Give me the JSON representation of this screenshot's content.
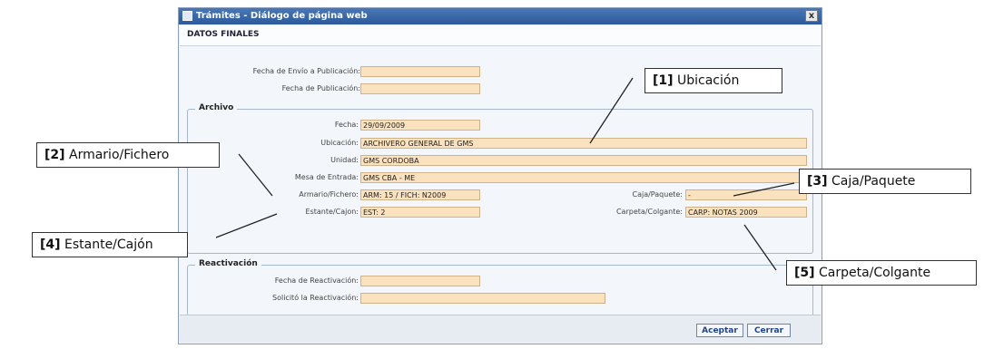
{
  "window": {
    "title": "Trámites - Diálogo de página web",
    "close_symbol": "x"
  },
  "header": {
    "title": "DATOS FINALES"
  },
  "fields": {
    "fecha_envio": {
      "label": "Fecha de Envío a Publicación:",
      "value": ""
    },
    "fecha_publicacion": {
      "label": "Fecha de Publicación:",
      "value": ""
    }
  },
  "archivo": {
    "legend": "Archivo",
    "fecha": {
      "label": "Fecha:",
      "value": "29/09/2009"
    },
    "ubicacion": {
      "label": "Ubicación:",
      "value": "ARCHIVERO GENERAL DE GMS"
    },
    "unidad": {
      "label": "Unidad:",
      "value": "GMS CORDOBA"
    },
    "mesa": {
      "label": "Mesa de Entrada:",
      "value": "GMS CBA - ME"
    },
    "armario": {
      "label": "Armario/Fichero:",
      "value": "ARM: 15 / FICH: N2009"
    },
    "caja": {
      "label": "Caja/Paquete:",
      "value": "-"
    },
    "estante": {
      "label": "Estante/Cajon:",
      "value": "EST: 2"
    },
    "carpeta": {
      "label": "Carpeta/Colgante:",
      "value": "CARP: NOTAS 2009"
    }
  },
  "reactivacion": {
    "legend": "Reactivación",
    "fecha": {
      "label": "Fecha de Reactivación:",
      "value": ""
    },
    "solicito": {
      "label": "Solicitó la Reactivación:",
      "value": ""
    }
  },
  "buttons": {
    "aceptar": "Aceptar",
    "cerrar": "Cerrar"
  },
  "callouts": {
    "c1": {
      "num": "[1]",
      "text": "Ubicación"
    },
    "c2": {
      "num": "[2]",
      "text": "Armario/Fichero"
    },
    "c3": {
      "num": "[3]",
      "text": "Caja/Paquete"
    },
    "c4": {
      "num": "[4]",
      "text": "Estante/Cajón"
    },
    "c5": {
      "num": "[5]",
      "text": "Carpeta/Colgante"
    }
  }
}
